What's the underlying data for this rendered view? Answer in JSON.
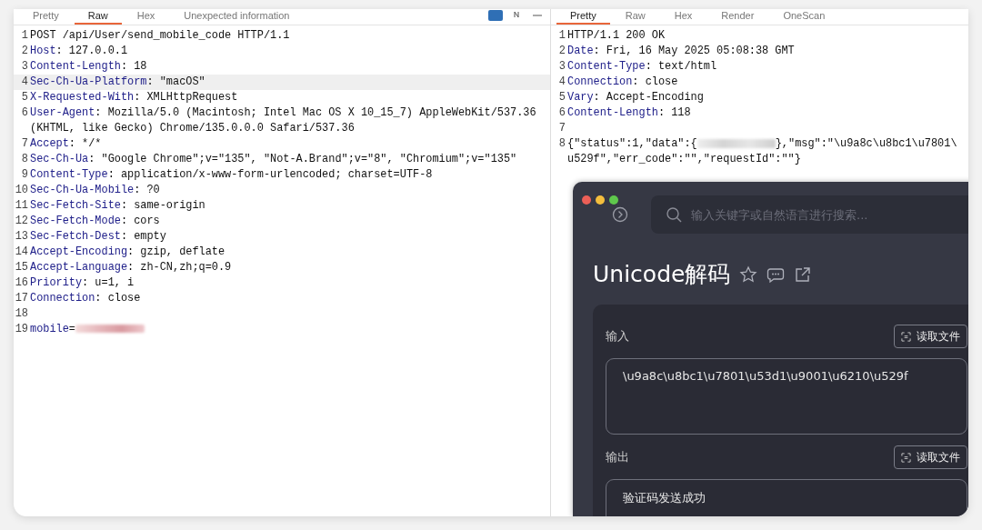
{
  "request": {
    "tabs": [
      {
        "label": "Pretty",
        "selected": false
      },
      {
        "label": "Raw",
        "selected": true
      },
      {
        "label": "Hex",
        "selected": false
      },
      {
        "label": "Unexpected information",
        "selected": false
      }
    ],
    "lines": [
      {
        "number": "1",
        "value": "POST /api/User/send_mobile_code HTTP/1.1",
        "highlighted": false
      },
      {
        "number": "2",
        "name": "Host",
        "value": ": 127.0.0.1",
        "highlighted": false
      },
      {
        "number": "3",
        "name": "Content-Length",
        "value": ": 18",
        "highlighted": false
      },
      {
        "number": "4",
        "name": "Sec-Ch-Ua-Platform",
        "value": ": \"macOS\"",
        "highlighted": true
      },
      {
        "number": "5",
        "name": "X-Requested-With",
        "value": ": XMLHttpRequest",
        "highlighted": false
      },
      {
        "number": "6",
        "name": "User-Agent",
        "value": ": Mozilla/5.0 (Macintosh; Intel Mac OS X 10_15_7) AppleWebKit/537.36 (KHTML, like Gecko) Chrome/135.0.0.0 Safari/537.36",
        "highlighted": false
      },
      {
        "number": "7",
        "name": "Accept",
        "value": ": */*",
        "highlighted": false
      },
      {
        "number": "8",
        "name": "Sec-Ch-Ua",
        "value": ": \"Google Chrome\";v=\"135\", \"Not-A.Brand\";v=\"8\", \"Chromium\";v=\"135\"",
        "highlighted": false
      },
      {
        "number": "9",
        "name": "Content-Type",
        "value": ": application/x-www-form-urlencoded; charset=UTF-8",
        "highlighted": false
      },
      {
        "number": "10",
        "name": "Sec-Ch-Ua-Mobile",
        "value": ": ?0",
        "highlighted": false
      },
      {
        "number": "11",
        "name": "Sec-Fetch-Site",
        "value": ": same-origin",
        "highlighted": false
      },
      {
        "number": "12",
        "name": "Sec-Fetch-Mode",
        "value": ": cors",
        "highlighted": false
      },
      {
        "number": "13",
        "name": "Sec-Fetch-Dest",
        "value": ": empty",
        "highlighted": false
      },
      {
        "number": "14",
        "name": "Accept-Encoding",
        "value": ": gzip, deflate",
        "highlighted": false
      },
      {
        "number": "15",
        "name": "Accept-Language",
        "value": ": zh-CN,zh;q=0.9",
        "highlighted": false
      },
      {
        "number": "16",
        "name": "Priority",
        "value": ": u=1, i",
        "highlighted": false
      },
      {
        "number": "17",
        "name": "Connection",
        "value": ": close",
        "highlighted": false
      },
      {
        "number": "18",
        "highlighted": false
      },
      {
        "number": "19",
        "name": "mobile",
        "value": "=",
        "redacted": true,
        "highlighted": false
      }
    ]
  },
  "response": {
    "tabs": [
      {
        "label": "Pretty",
        "selected": true
      },
      {
        "label": "Raw",
        "selected": false
      },
      {
        "label": "Hex",
        "selected": false
      },
      {
        "label": "Render",
        "selected": false
      },
      {
        "label": "OneScan",
        "selected": false
      }
    ],
    "lines": [
      {
        "number": "1",
        "value": "HTTP/1.1 200 OK",
        "highlighted": false
      },
      {
        "number": "2",
        "name": "Date",
        "value": ": Fri, 16 May 2025 05:08:38 GMT",
        "highlighted": false
      },
      {
        "number": "3",
        "name": "Content-Type",
        "value": ": text/html",
        "highlighted": false
      },
      {
        "number": "4",
        "name": "Connection",
        "value": ": close",
        "highlighted": false
      },
      {
        "number": "5",
        "name": "Vary",
        "value": ": Accept-Encoding",
        "highlighted": false
      },
      {
        "number": "6",
        "name": "Content-Length",
        "value": ": 118",
        "highlighted": false
      },
      {
        "number": "7",
        "highlighted": false
      },
      {
        "number": "8",
        "value": "{\"status\":1,\"data\":{",
        "redacted": true,
        "after": "},\"msg\":\"\\u9a8c\\u8bc1\\u7801\\",
        "wrap": "u529f\",\"err_code\":\"\",\"requestId\":\"\"}",
        "highlighted": false
      }
    ]
  },
  "decoder": {
    "search": {
      "placeholder": "输入关键字或自然语言进行搜索..."
    },
    "title": "Unicode解码",
    "input": {
      "label": "输入",
      "button": "读取文件",
      "value": "\\u9a8c\\u8bc1\\u7801\\u53d1\\u9001\\u6210\\u529f"
    },
    "output": {
      "label": "输出",
      "button": "读取文件",
      "value": "验证码发送成功"
    }
  }
}
